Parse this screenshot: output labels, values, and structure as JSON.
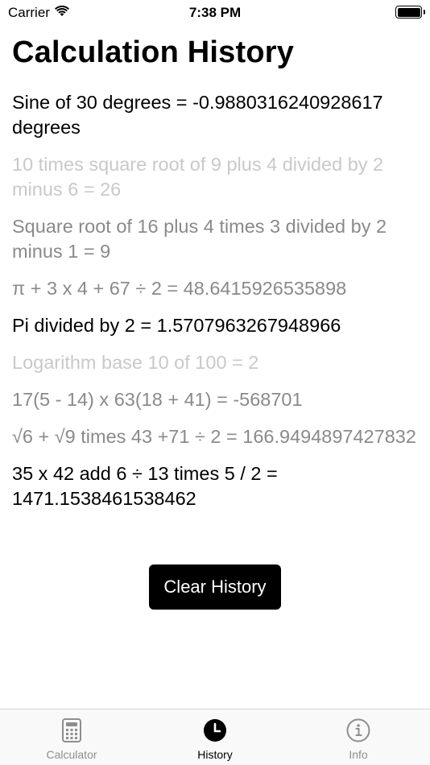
{
  "status_bar": {
    "carrier": "Carrier",
    "time": "7:38 PM"
  },
  "page_title": "Calculation History",
  "history": [
    {
      "text": "Sine of 30 degrees = -0.9880316240928617 degrees",
      "tone": "dark"
    },
    {
      "text": "10 times square root of 9 plus 4 divided by 2 minus 6 = 26",
      "tone": "light"
    },
    {
      "text": "Square root of 16 plus 4 times 3 divided by 2 minus 1 = 9",
      "tone": "medium"
    },
    {
      "text": "π + 3 x 4 + 67 ÷ 2 = 48.6415926535898",
      "tone": "medium"
    },
    {
      "text": "Pi divided by 2 = 1.5707963267948966",
      "tone": "dark"
    },
    {
      "text": "Logarithm base 10 of 100 = 2",
      "tone": "light"
    },
    {
      "text": "17(5 - 14) x 63(18 + 41) = -568701",
      "tone": "medium"
    },
    {
      "text": "√6 + √9 times 43 +71 ÷ 2 = 166.9494897427832",
      "tone": "medium"
    },
    {
      "text": "35 x 42 add 6 ÷ 13 times 5 / 2 = 1471.1538461538462",
      "tone": "dark"
    }
  ],
  "clear_button": "Clear History",
  "tabs": [
    {
      "label": "Calculator",
      "icon": "calculator-icon",
      "active": false
    },
    {
      "label": "History",
      "icon": "clock-icon",
      "active": true
    },
    {
      "label": "Info",
      "icon": "info-icon",
      "active": false
    }
  ],
  "colors": {
    "dark": "#000000",
    "medium": "#8a8a8a",
    "light": "#c9c9c9",
    "button_bg": "#000000"
  }
}
